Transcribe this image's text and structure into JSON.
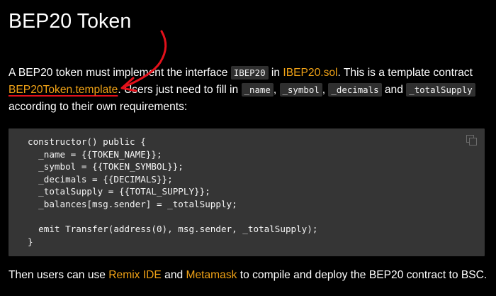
{
  "title": "BEP20 Token",
  "intro": {
    "t1": "A BEP20 token must implement the interface ",
    "code_interface": "IBEP20",
    "t2": " in ",
    "link_ibep20": "IBEP20.sol",
    "t3": ". This is a template contract ",
    "link_template": "BEP20Token.template",
    "t4": ". Users just need to fill in ",
    "code_name": "_name",
    "sep1": ", ",
    "code_symbol": "_symbol",
    "sep2": ", ",
    "code_decimals": "_decimals",
    "t5": " and ",
    "code_total": "_totalSupply",
    "t6": " according to their own requirements:"
  },
  "code_block": {
    "lines": [
      "constructor() public {",
      "  _name = {{TOKEN_NAME}};",
      "  _symbol = {{TOKEN_SYMBOL}};",
      "  _decimals = {{DECIMALS}};",
      "  _totalSupply = {{TOTAL_SUPPLY}};",
      "  _balances[msg.sender] = _totalSupply;",
      "",
      "  emit Transfer(address(0), msg.sender, _totalSupply);",
      "}"
    ],
    "copy_icon": "copy-icon"
  },
  "outro": {
    "t1": "Then users can use ",
    "link_remix": "Remix IDE",
    "t2": " and ",
    "link_metamask": "Metamask",
    "t3": " to compile and deploy the BEP20 contract to BSC."
  },
  "colors": {
    "background": "#000000",
    "link": "#f0a216",
    "code_bg": "#353535",
    "annotation": "#e3111b"
  }
}
